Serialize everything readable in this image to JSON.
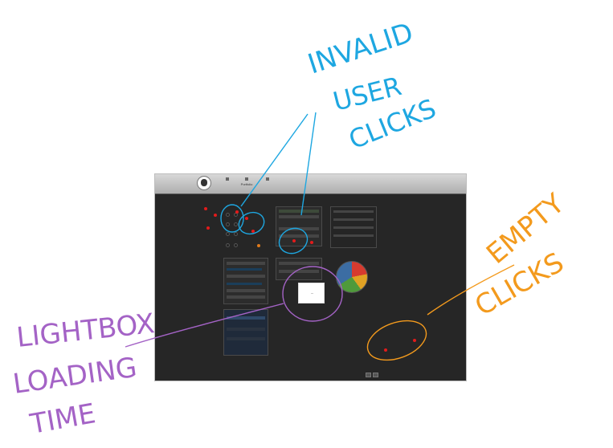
{
  "app": {
    "nav": [
      {
        "label": ""
      },
      {
        "label": "Portfolio"
      },
      {
        "label": ""
      }
    ],
    "footer_text": ""
  },
  "annotations": {
    "invalid": {
      "lines": [
        "INVALID",
        "USER",
        "CLICKS"
      ],
      "color": "#1ea7e1"
    },
    "empty": {
      "lines": [
        "EMPTY",
        "CLICKS"
      ],
      "color": "#f39a1d"
    },
    "lightbox": {
      "lines": [
        "LIGHTBOX",
        "LOADING",
        "TIME"
      ],
      "color": "#a463c6"
    }
  },
  "colors": {
    "click_marker": "#e31b1b",
    "screen_bg": "#3b3b3b",
    "topbar": "#bcbcbc"
  },
  "icons": {
    "user_avatar": "avatar-face-icon",
    "nav_flag": "flag-icon",
    "nav_portfolio": "portfolio-icon",
    "nav_doc": "document-icon"
  }
}
